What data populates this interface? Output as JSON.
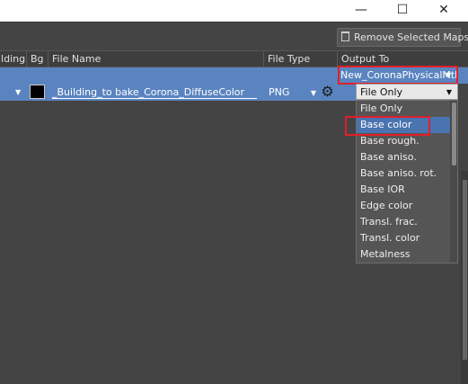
{
  "window": {
    "minimize_glyph": "—",
    "maximize_glyph": "☐",
    "close_glyph": "✕"
  },
  "toolbar": {
    "remove_label": "Remove Selected Maps"
  },
  "table": {
    "headers": {
      "building": "ilding",
      "bg": "Bg",
      "file_name": "File Name",
      "file_type": "File Type",
      "output_to": "Output To"
    },
    "row": {
      "file_name": "_Building_to bake_Corona_DiffuseColor",
      "file_type": "PNG",
      "output_to": "New_CoronaPhysicalMtl"
    }
  },
  "dropdown": {
    "current": "File Only",
    "items": [
      "File Only",
      "Base color",
      "Base rough.",
      "Base aniso.",
      "Base aniso. rot.",
      "Base IOR",
      "Edge color",
      "Transl. frac.",
      "Transl. color",
      "Metalness"
    ],
    "highlighted_index": 1
  },
  "colors": {
    "selection": "#5a84c0",
    "highlight_box": "#e0202a",
    "background": "#444444"
  }
}
